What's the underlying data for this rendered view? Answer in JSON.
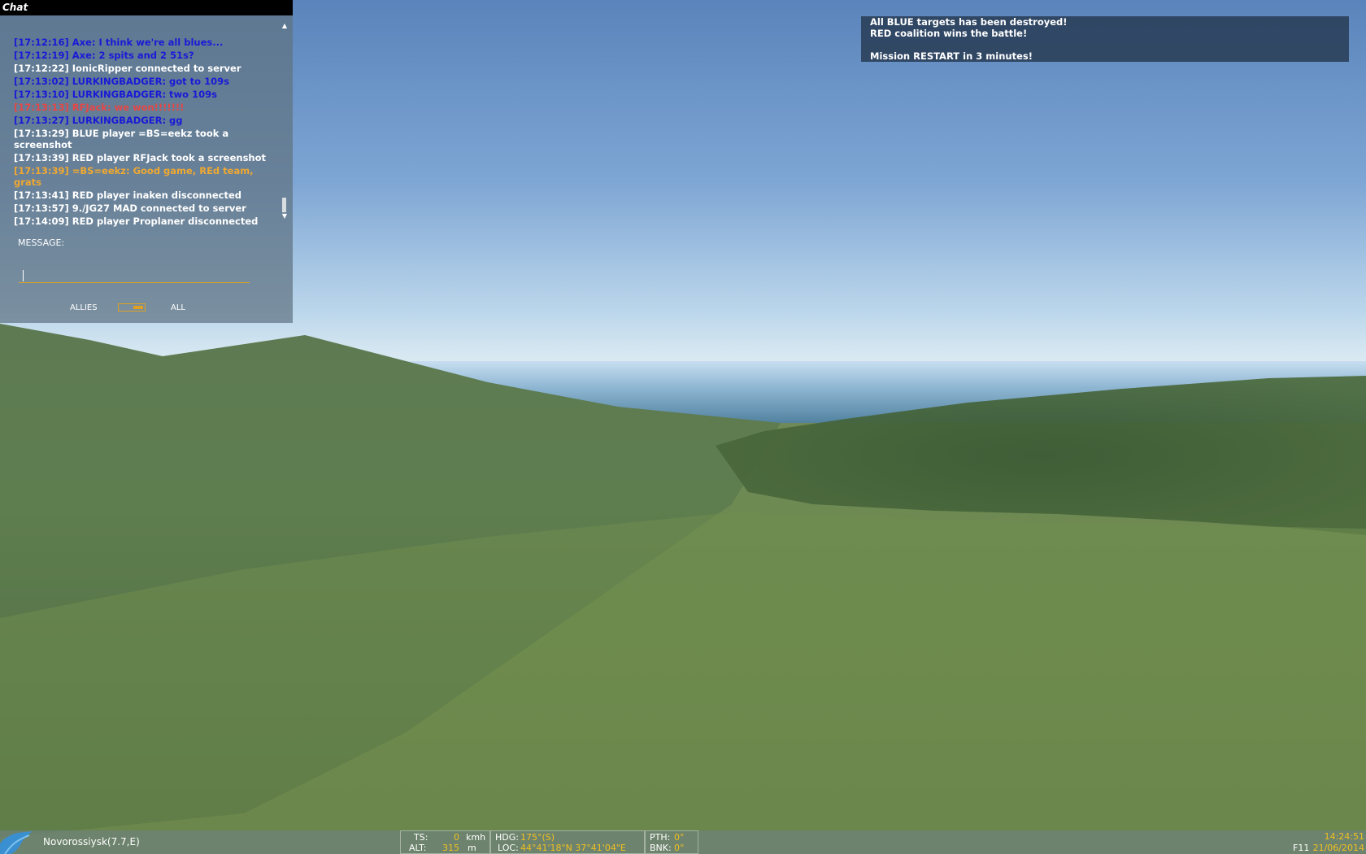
{
  "chat": {
    "title": "Chat",
    "messages": [
      {
        "text": "[17:12:16] Axe: I think we're all blues...",
        "color": "blue"
      },
      {
        "text": "[17:12:19] Axe: 2 spits and 2 51s?",
        "color": "blue"
      },
      {
        "text": "[17:12:22] IonicRipper connected to server",
        "color": "white"
      },
      {
        "text": "[17:13:02] LURKINGBADGER: got to 109s",
        "color": "blue"
      },
      {
        "text": "[17:13:10] LURKINGBADGER: two 109s",
        "color": "blue"
      },
      {
        "text": "[17:13:13] RFJack: we won!!!!!!!",
        "color": "red"
      },
      {
        "text": "[17:13:27] LURKINGBADGER: gg",
        "color": "blue"
      },
      {
        "text": "[17:13:29] BLUE player =BS=eekz took a screenshot",
        "color": "white"
      },
      {
        "text": "[17:13:39] RED player RFJack took a screenshot",
        "color": "white"
      },
      {
        "text": "[17:13:39] =BS=eekz: Good game, REd team, grats",
        "color": "orange"
      },
      {
        "text": "[17:13:41] RED player inaken disconnected",
        "color": "white"
      },
      {
        "text": "[17:13:57] 9./JG27 MAD connected to server",
        "color": "white"
      },
      {
        "text": "[17:14:09] RED player Proplaner disconnected",
        "color": "white"
      }
    ],
    "message_label": "MESSAGE:",
    "message_value": "",
    "allies_label": "ALLIES",
    "all_label": "ALL",
    "channel_toggle_on": "all",
    "icons": {
      "scroll_up": "scroll-up-arrow-icon",
      "scroll_down": "scroll-down-arrow-icon"
    }
  },
  "banner": {
    "line1": "All BLUE targets has been destroyed!",
    "line2": "RED coalition wins the battle!",
    "line4": "Mission RESTART in 3 minutes!"
  },
  "status": {
    "location": "Novorossiysk(7.7,E)",
    "ts_label": "TS:",
    "ts_value": "0",
    "ts_unit": "kmh",
    "alt_label": "ALT:",
    "alt_value": "315",
    "alt_unit": "m",
    "hdg_label": "HDG:",
    "hdg_value": "175°(S)",
    "loc_label": "LOC:",
    "loc_value": "44°41'18\"N 37°41'04\"E",
    "pth_label": "PTH:",
    "pth_value": "0°",
    "bnk_label": "BNK:",
    "bnk_value": "0°",
    "time": "14:24:51",
    "hotkey": "F11",
    "date": "21/06/2014"
  },
  "colors": {
    "chat_blue": "#1a1ad6",
    "chat_white": "#ffffff",
    "chat_red": "#e64646",
    "chat_orange": "#f0a830",
    "hud_value": "#f0c020",
    "accent": "#e0a020"
  }
}
